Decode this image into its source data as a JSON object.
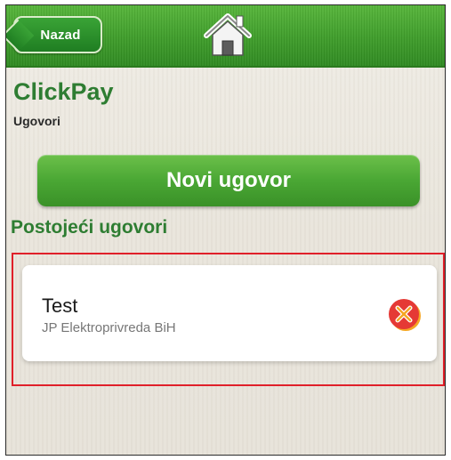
{
  "header": {
    "back_label": "Nazad",
    "home_icon": "home-icon",
    "back_icon": "back-arrow-icon"
  },
  "app": {
    "title": "ClickPay",
    "subtitle": "Ugovori"
  },
  "actions": {
    "new_contract_label": "Novi ugovor"
  },
  "contracts_section": {
    "title": "Postojeći ugovori",
    "items": [
      {
        "name": "Test",
        "provider": "JP Elektroprivreda BiH",
        "delete_icon": "delete-icon"
      }
    ]
  },
  "colors": {
    "header_green": "#3e9c2a",
    "title_green": "#2e7d32",
    "button_green": "#4aa734",
    "highlight_red": "#e0202a",
    "delete_red": "#e53935",
    "delete_orange": "#f5a623"
  }
}
